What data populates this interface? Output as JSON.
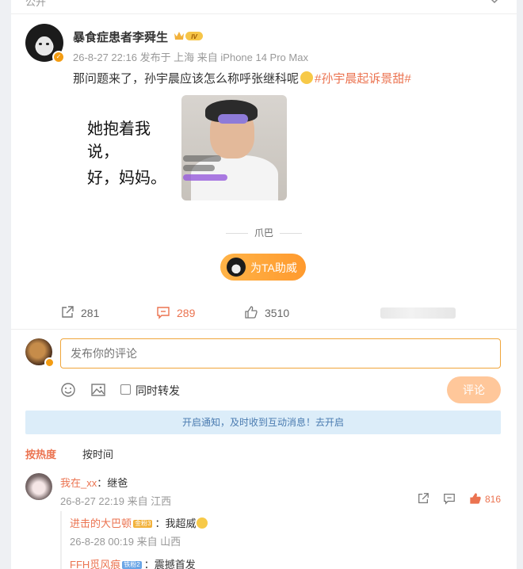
{
  "topbar": {
    "visibility": "公开",
    "chevron_icon": "chevron-down-icon"
  },
  "post": {
    "username": "暴食症患者李舜生",
    "level_badge": "IV",
    "meta": "26-8-27 22:16  发布于 上海  来自 iPhone 14 Pro Max",
    "text_main": "那问题来了，孙宇晨应该怎么称呼张继科呢",
    "hashtag": "#孙宇晨起诉景甜#",
    "image_text_line1": "她抱着我说，",
    "image_text_line2": "好，妈妈。",
    "signature": "爪巴",
    "cheer_label": "为TA助威"
  },
  "actions": {
    "share_count": "281",
    "comment_count": "289",
    "like_count": "3510"
  },
  "composer": {
    "placeholder": "发布你的评论",
    "repost_label": "同时转发",
    "submit_label": "评论"
  },
  "notice": "开启通知，及时收到互动消息！去开启",
  "sort": {
    "hot": "按热度",
    "time": "按时间"
  },
  "comments": [
    {
      "user": "我在_xx",
      "text": "：继爸",
      "meta": "26-8-27 22:19 来自 江西",
      "like_count": "816",
      "replies": [
        {
          "user": "进击的大巴顿",
          "badge": "金粉3",
          "text": "：我超威",
          "meta": "26-8-28 00:19 来自 山西"
        },
        {
          "user": "FFH觅风痕",
          "badge": "铁粉2",
          "text": "：震撼首发"
        }
      ]
    }
  ],
  "colors": {
    "accent": "#eb7350",
    "notice_bg": "#dcedf9",
    "submit_bg": "#ffc79a"
  }
}
